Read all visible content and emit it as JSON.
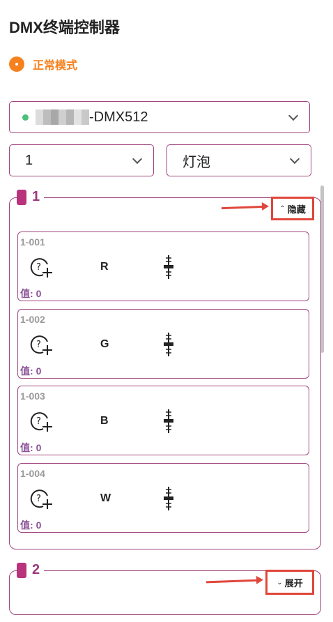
{
  "header": {
    "title": "DMX终端控制器"
  },
  "mode": {
    "label": "正常模式",
    "color": "#f5821f"
  },
  "device_select": {
    "status_color": "#4cbf7a",
    "name_suffix": "-DMX512",
    "blur_colors": [
      "#dcdcdc",
      "#bdbdbd",
      "#a8a8a8",
      "#cfcfcf",
      "#b5b5b5",
      "#e2e2e2",
      "#c9c9c9"
    ]
  },
  "universe_select": {
    "value": "1"
  },
  "type_select": {
    "value": "灯泡"
  },
  "groups": [
    {
      "number": "1",
      "toggle_label": "隐藏",
      "toggle_chevron": "^",
      "channels": [
        {
          "id": "1-001",
          "label": "R",
          "value_prefix": "值:",
          "value": "0"
        },
        {
          "id": "1-002",
          "label": "G",
          "value_prefix": "值:",
          "value": "0"
        },
        {
          "id": "1-003",
          "label": "B",
          "value_prefix": "值:",
          "value": "0"
        },
        {
          "id": "1-004",
          "label": "W",
          "value_prefix": "值:",
          "value": "0"
        }
      ]
    },
    {
      "number": "2",
      "toggle_label": "展开",
      "toggle_chevron": "v",
      "channels": []
    }
  ],
  "colors": {
    "accent": "#a0447f",
    "group_marker": "#b8337b",
    "annotation": "#e0463a"
  }
}
